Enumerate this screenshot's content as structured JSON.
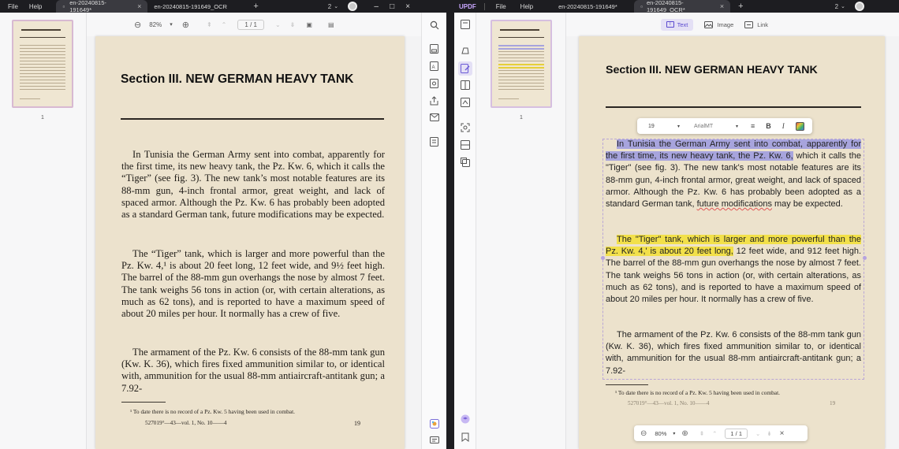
{
  "left": {
    "menu": [
      "File",
      "Help"
    ],
    "tabs": [
      {
        "label": "en-20240815-191649*",
        "active": true
      },
      {
        "label": "en-20240815-191649_OCR",
        "active": false
      }
    ],
    "tab_count": "2",
    "toolbar": {
      "zoom": "82%",
      "page_value": "1",
      "page_total": "/ 1"
    },
    "thumb_page": "1",
    "page": {
      "title": "Section III. NEW GERMAN HEAVY TANK",
      "paragraphs": [
        "In Tunisia the German Army sent into combat, apparently for the first time, its new heavy tank, the Pz. Kw. 6, which it calls the “Tiger” (see fig. 3). The new tank’s most notable features are its 88-mm gun, 4-inch frontal armor, great weight, and lack of spaced armor. Although the Pz. Kw. 6 has probably been adopted as a standard German tank, future modifications may be expected.",
        "The “Tiger” tank, which is larger and more powerful than the Pz. Kw. 4,¹ is about 20 feet long, 12 feet wide, and 9½ feet high. The barrel of the 88-mm gun overhangs the nose by almost 7 feet. The tank weighs 56 tons in action (or, with certain alterations, as much as 62 tons), and is reported to have a maximum speed of about 20 miles per hour. It normally has a crew of five.",
        "The armament of the Pz. Kw. 6 consists of the 88-mm tank gun (Kw. K. 36), which fires fixed ammunition similar to, or identical with, ammunition for the usual 88-mm antiaircraft-antitank gun; a 7.92-"
      ],
      "footnote": "¹ To date there is no record of a Pz. Kw. 5 having been used in combat.",
      "footer_left": "527019°—43—vol. 1, No. 10——4",
      "footer_right": "19"
    }
  },
  "right": {
    "brand": "UPDF",
    "menu": [
      "File",
      "Help"
    ],
    "tabs": [
      {
        "label": "en-20240815-191649*",
        "active": false
      },
      {
        "label": "en-20240815-191649_OCR*",
        "active": true
      }
    ],
    "tab_count": "2",
    "toolbar": {
      "text": "Text",
      "image": "Image",
      "link": "Link"
    },
    "thumb_page": "1",
    "format_bar": {
      "font_size": "19",
      "font_name": "ArialMT",
      "bold": "B",
      "italic": "I"
    },
    "page": {
      "title": "Section III. NEW GERMAN HEAVY TANK",
      "p1_highlight": "In Tunisia the German Army sent into combat, apparently for the first time, its new heavy tank, the Pz. Kw. 6,",
      "p1_rest_a": " which it calls the \"Tiger\" (see fig. 3). The new tank's most notable features are its 88-mm gun, 4-inch frontal armor, great weight, and lack of spaced armor. Although the Pz. Kw. 6 has probably been adopted as a standard German tank, ",
      "p1_squiggle": "future modifications",
      "p1_rest_b": " may be expected.",
      "p2_highlight": "The \"Tiger\" tank, which is larger and more powerful than the Pz. Kw. 4,' is about 20 feet long,",
      "p2_rest": " 12 feet wide, and 912 feet high. The barrel of the 88-mm gun overhangs the nose by almost 7 feet. The tank weighs 56 tons in action (or, with certain alterations, as much as 62 tons), and is reported to have a maximum speed of about 20 miles per hour. It normally has a crew of five.",
      "p3": "The armament of the Pz. Kw. 6 consists of the 88-mm tank gun (Kw. K. 36), which fires fixed ammunition similar to, or identical with, ammunition for the usual 88-mm antiaircraft-antitank gun; a 7.92-",
      "footnote": "¹ To date there is no record of a Pz. Kw. 5 having been used in combat.",
      "footer_left": "527019°—43—vol. 1, No. 10——4",
      "footer_right": "19"
    },
    "zoom_bar": {
      "zoom": "80%",
      "page_value": "1",
      "page_total": "/ 1"
    }
  }
}
